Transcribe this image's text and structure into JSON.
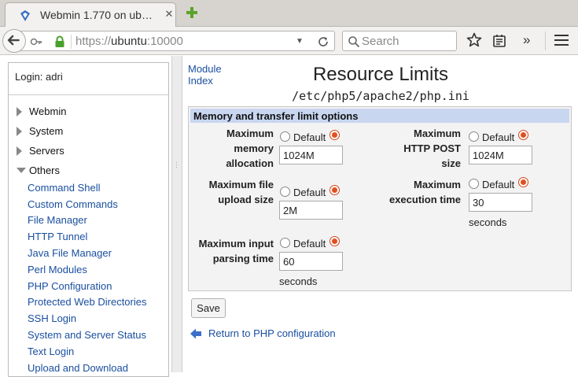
{
  "browser": {
    "tab_title": "Webmin 1.770 on ub…",
    "url_scheme": "https://",
    "url_host": "ubuntu",
    "url_port": ":10000",
    "search_placeholder": "Search"
  },
  "sidebar": {
    "login_text": "Login: adri",
    "categories": [
      {
        "label": "Webmin"
      },
      {
        "label": "System"
      },
      {
        "label": "Servers"
      },
      {
        "label": "Others"
      }
    ],
    "links": [
      {
        "label": "Command Shell"
      },
      {
        "label": "Custom Commands"
      },
      {
        "label": "File Manager"
      },
      {
        "label": "HTTP Tunnel"
      },
      {
        "label": "Java File Manager"
      },
      {
        "label": "Perl Modules"
      },
      {
        "label": "PHP Configuration"
      },
      {
        "label": "Protected Web Directories"
      },
      {
        "label": "SSH Login"
      },
      {
        "label": "System and Server Status"
      },
      {
        "label": "Text Login"
      },
      {
        "label": "Upload and Download"
      }
    ]
  },
  "main": {
    "module_index": "Module\nIndex",
    "title": "Resource Limits",
    "subtitle": "/etc/php5/apache2/php.ini",
    "section_title": "Memory and transfer limit options",
    "default_label": "Default",
    "fields": {
      "max_memory": {
        "label": "Maximum memory allocation",
        "value": "1024M"
      },
      "max_post": {
        "label": "Maximum HTTP POST size",
        "value": "1024M"
      },
      "max_upload": {
        "label": "Maximum file upload size",
        "value": "2M"
      },
      "max_exec": {
        "label": "Maximum execution time",
        "value": "30",
        "unit": "seconds"
      },
      "max_input": {
        "label": "Maximum input parsing time",
        "value": "60",
        "unit": "seconds"
      }
    },
    "save_label": "Save",
    "return_link": "Return to PHP configuration"
  }
}
